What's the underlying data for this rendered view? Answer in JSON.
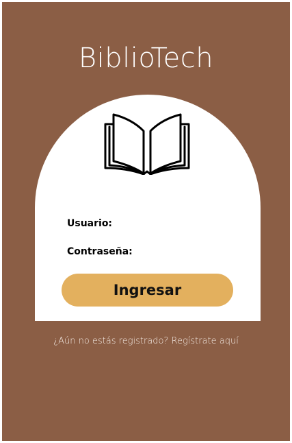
{
  "app": {
    "title": "BiblioTech"
  },
  "login": {
    "icon": "open-book-icon",
    "username_label": "Usuario:",
    "username_value": "",
    "password_label": "Contraseña:",
    "password_value": "",
    "submit_label": "Ingresar"
  },
  "register": {
    "prompt": "¿Aún no estás registrado? Regístrate aquí"
  },
  "colors": {
    "background": "#8b5e45",
    "card": "#ffffff",
    "button": "#e3b05e",
    "text_light": "#ffffff"
  }
}
